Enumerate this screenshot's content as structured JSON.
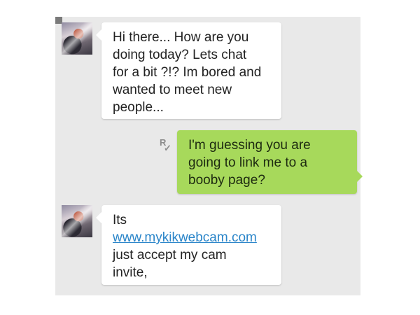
{
  "chat": {
    "background": "#e9e9e9",
    "outgoing_bubble_color": "#a7d95b",
    "link_color": "#2a85c9",
    "messages": [
      {
        "direction": "incoming",
        "lines": [
          "Hi there... How are you",
          "doing today? Lets chat",
          "for a bit ?!? Im bored and",
          "wanted to meet new",
          "people..."
        ]
      },
      {
        "direction": "outgoing",
        "receipt_letter": "R",
        "receipt_icon": "check-icon",
        "lines": [
          "I'm guessing you are",
          "going to link me to a",
          "booby page?"
        ]
      },
      {
        "direction": "incoming",
        "lines": [
          "Its",
          "www.mykikwebcam.com",
          "just accept my cam",
          "invite,"
        ]
      }
    ]
  }
}
